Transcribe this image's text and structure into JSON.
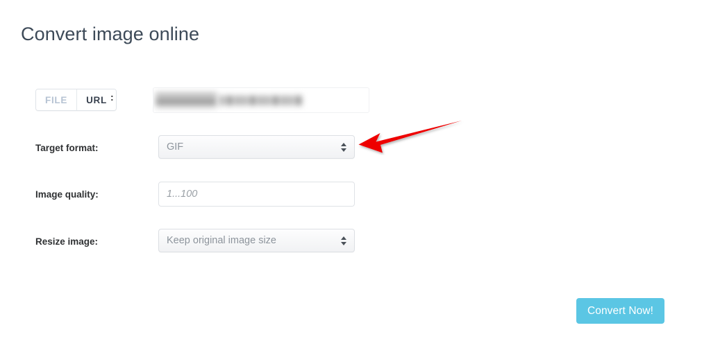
{
  "page": {
    "title": "Convert image online",
    "background_color": "#ffffff",
    "title_color": "#3d4a58"
  },
  "form": {
    "source_row": {
      "toggle": {
        "file_label": "FILE",
        "url_label": "URL",
        "active": "URL",
        "file_color": "#b6c3d3",
        "url_color": "#39424f"
      },
      "separator": ":",
      "url_input": {
        "value": "",
        "placeholder": "",
        "redacted": true,
        "note": "blurred"
      }
    },
    "target_format": {
      "label": "Target format:",
      "value": "GIF",
      "control": "select",
      "stepper_icon": "up-down-stepper-icon"
    },
    "image_quality": {
      "label": "Image quality:",
      "value": "",
      "placeholder": "1...100",
      "control": "text-input"
    },
    "resize_image": {
      "label": "Resize image:",
      "value": "Keep original image size",
      "control": "select",
      "stepper_icon": "up-down-stepper-icon"
    },
    "submit": {
      "label": "Convert Now!",
      "color": "#5bc6e4",
      "text_color": "#ffffff"
    }
  },
  "annotation": {
    "arrow": {
      "name": "red-arrow-icon",
      "color": "#ee0000",
      "points_to": "target-format-select",
      "direction": "left"
    }
  }
}
